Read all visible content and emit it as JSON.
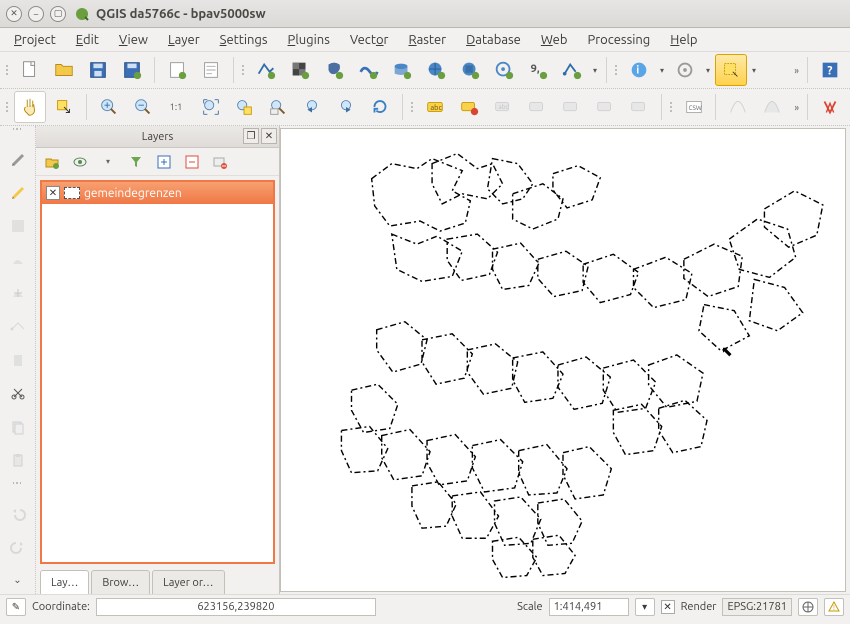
{
  "window": {
    "title": "QGIS da5766c - bpav5000sw"
  },
  "menu": [
    "Project",
    "Edit",
    "View",
    "Layer",
    "Settings",
    "Plugins",
    "Vector",
    "Raster",
    "Database",
    "Web",
    "Processing",
    "Help"
  ],
  "panel": {
    "title": "Layers",
    "layer_name": "gemeindegrenzen"
  },
  "tabs": [
    "Lay…",
    "Brow…",
    "Layer or…"
  ],
  "status": {
    "coord_label": "Coordinate:",
    "coord_value": "623156,239820",
    "scale_label": "Scale",
    "scale_value": "1:414,491",
    "render_label": "Render",
    "crs_value": "EPSG:21781"
  }
}
